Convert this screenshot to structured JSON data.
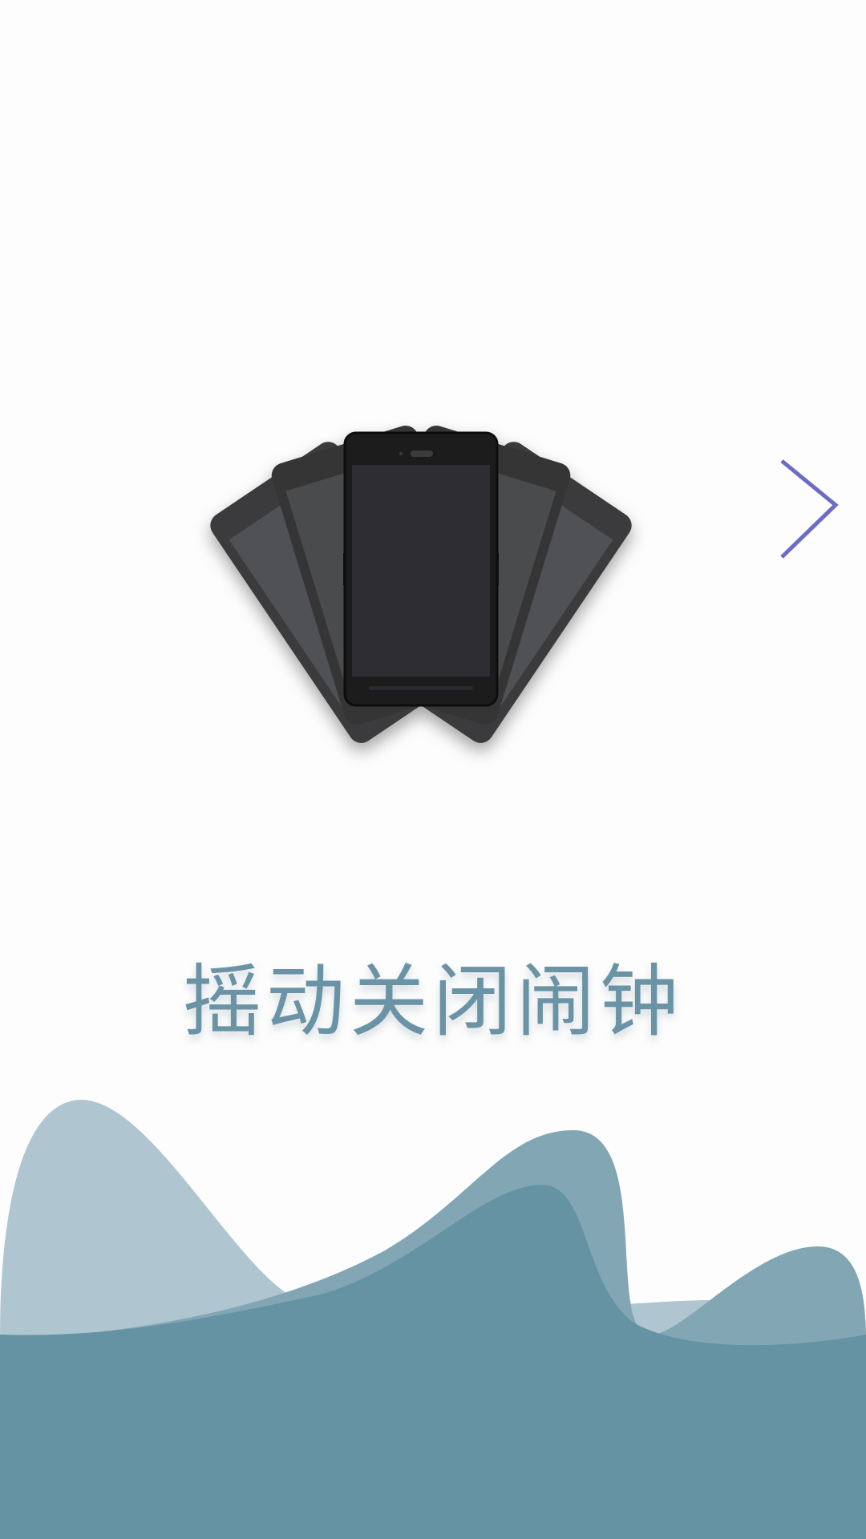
{
  "intro": {
    "caption": "摇动关闭闹钟"
  },
  "icons": {
    "illustration": "fanned-phones-illustration",
    "next": "chevron-right-icon"
  },
  "colors": {
    "background": "#fdfdfd",
    "caption": "#6a93a5",
    "arrow": "#6b6cc4",
    "wave_dark": "#6593a3",
    "wave_mid": "#82a6b4",
    "wave_light": "#afc6d0",
    "phone_body": "#1c1c1e",
    "phone_screen": "#2e2f32"
  }
}
